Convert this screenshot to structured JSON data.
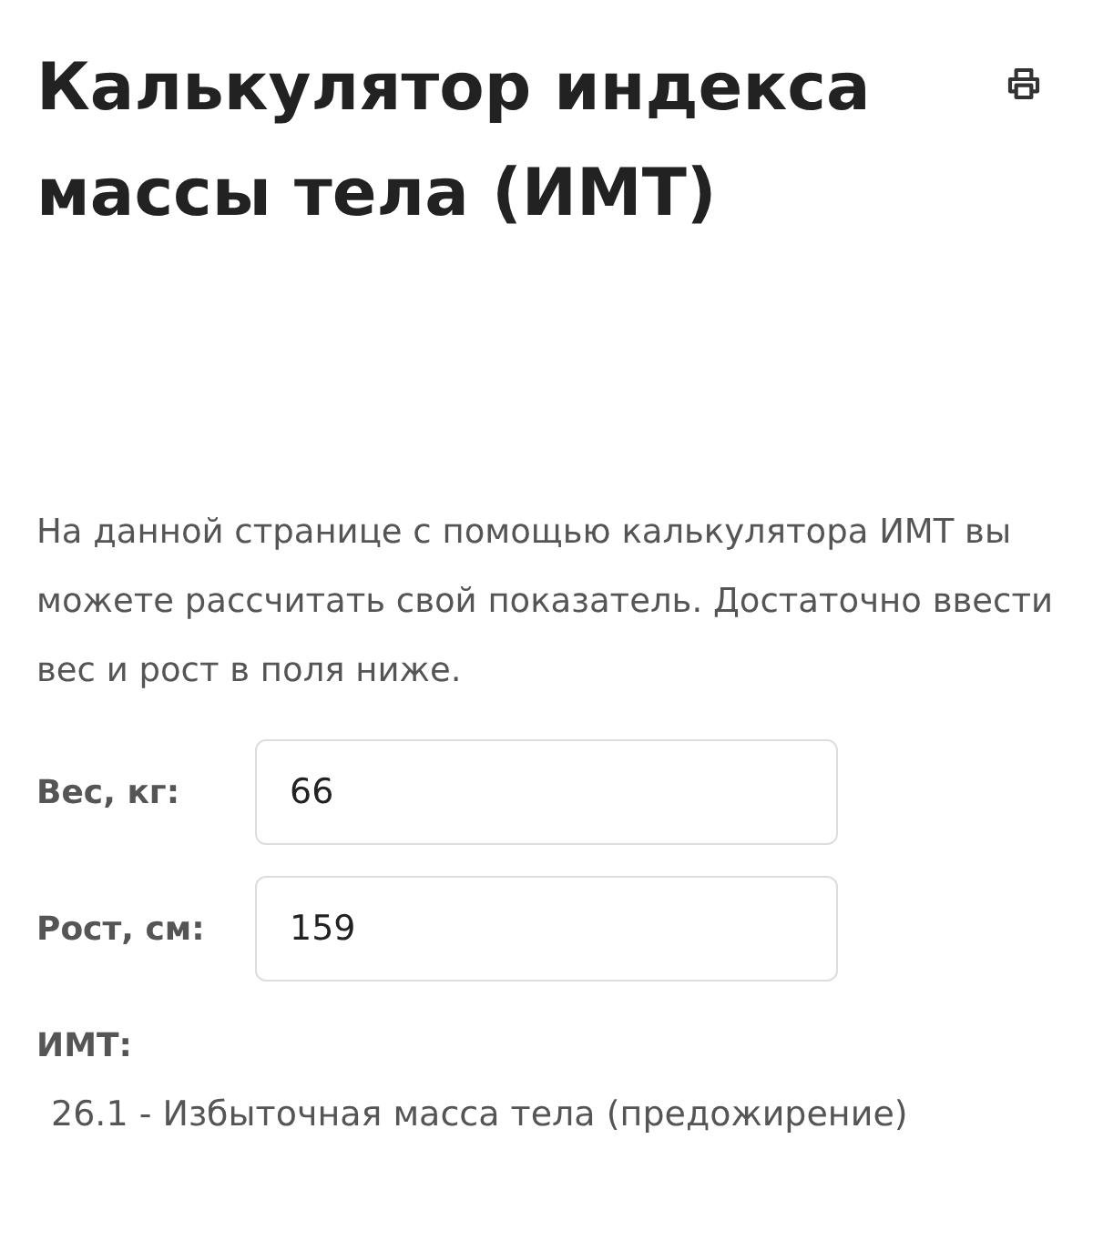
{
  "title": "Калькулятор индекса массы тела (ИМТ)",
  "intro": "На данной странице с помощью калькулятора ИМТ вы можете рассчитать свой показатель. Достаточно ввести вес и рост в поля ниже.",
  "fields": [
    {
      "label": "Вес, кг:",
      "value": "66"
    },
    {
      "label": "Рост, см:",
      "value": "159"
    }
  ],
  "result": {
    "label": "ИМТ:",
    "value": "26.1 - Избыточная масса тела (предожирение)"
  }
}
